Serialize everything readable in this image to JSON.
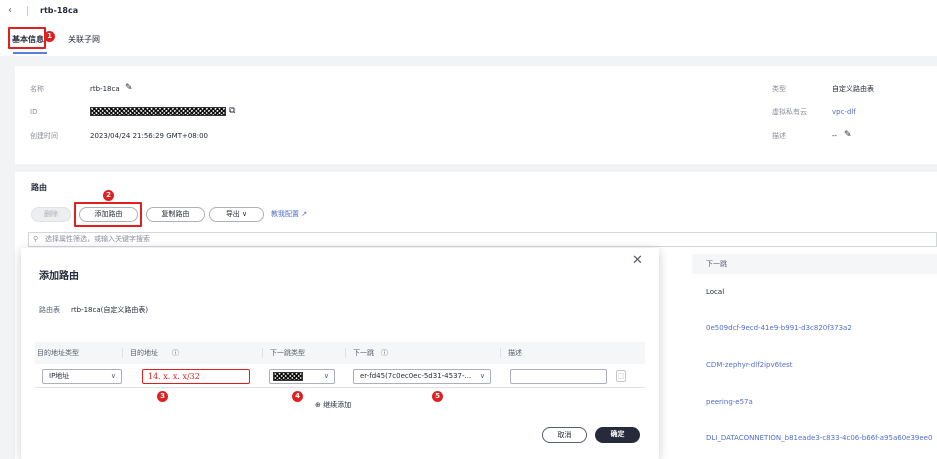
{
  "header": {
    "back_icon": "chevron-left-icon",
    "title": "rtb-18ca"
  },
  "tabs": [
    {
      "label": "基本信息"
    },
    {
      "label": "关联子网"
    }
  ],
  "badges": {
    "b1": "1",
    "b2": "2",
    "b3": "3",
    "b4": "4",
    "b5": "5"
  },
  "info": {
    "name_label": "名称",
    "name_value": "rtb-18ca",
    "id_label": "ID",
    "created_label": "创建时间",
    "created_value": "2023/04/24 21:56:29 GMT+08:00",
    "type_label": "类型",
    "type_value": "自定义路由表",
    "vpc_label": "虚拟私有云",
    "vpc_value": "vpc-dlf",
    "desc_label": "描述",
    "desc_value": "--"
  },
  "routes": {
    "title": "路由",
    "delete_btn": "删除",
    "add_btn": "添加路由",
    "copy_btn": "复制路由",
    "export_btn": "导出",
    "learn_link": "教我配置",
    "search_placeholder": "选择属性筛选，或输入关键字搜索",
    "next_hop_header": "下一跳",
    "next_hops": [
      "Local",
      "0e509dcf-9ecd-41e9-b991-d3c820f373a2",
      "CDM-zephyr-dlf2ipv6test",
      "peering-e57a",
      "DLI_DATACONNETION_b81eade3-c833-4c06-b66f-a95a60e39ee0"
    ]
  },
  "dialog": {
    "title": "添加路由",
    "route_table_label": "路由表",
    "route_table_value": "rtb-18ca(自定义路由表)",
    "col_dest_type": "目的地址类型",
    "col_dest": "目的地址",
    "col_next_type": "下一跳类型",
    "col_next": "下一跳",
    "col_desc": "描述",
    "dest_type_value": "IP地址",
    "dest_value": "14. x. x. x/32",
    "next_value": "er-fd45(7c0ec0ec-5d31-4537-...",
    "add_more": "继续添加",
    "cancel": "取消",
    "confirm": "确定"
  },
  "colors": {
    "accent": "#526ecc",
    "highlight": "#e02020",
    "primary_dark": "#252b3a"
  }
}
